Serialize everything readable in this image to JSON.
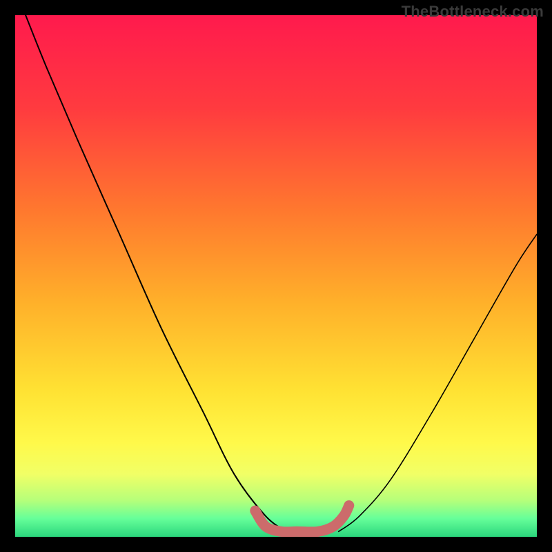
{
  "watermark": {
    "text": "TheBottleneck.com"
  },
  "chart_data": {
    "type": "line",
    "title": "",
    "xlabel": "",
    "ylabel": "",
    "xlim": [
      0,
      100
    ],
    "ylim": [
      0,
      100
    ],
    "grid": false,
    "series": [
      {
        "name": "curve-left",
        "color": "#000000",
        "x": [
          2,
          6,
          12,
          20,
          28,
          36,
          42,
          48,
          52
        ],
        "y": [
          100,
          90,
          76,
          58,
          40,
          24,
          12,
          4,
          1
        ]
      },
      {
        "name": "curve-right",
        "color": "#000000",
        "x": [
          62,
          66,
          72,
          80,
          88,
          96,
          100
        ],
        "y": [
          1,
          4,
          11,
          24,
          38,
          52,
          58
        ]
      },
      {
        "name": "highlight-bottom",
        "color": "#cc6b6b",
        "x": [
          46,
          48,
          51,
          54,
          58,
          61,
          63,
          64
        ],
        "y": [
          5,
          2,
          1,
          1,
          1,
          2,
          4,
          6
        ]
      }
    ],
    "background_gradient": {
      "stops": [
        {
          "offset": 0.0,
          "color": "#ff1a4d"
        },
        {
          "offset": 0.18,
          "color": "#ff3b3f"
        },
        {
          "offset": 0.38,
          "color": "#ff7a2e"
        },
        {
          "offset": 0.55,
          "color": "#ffb02a"
        },
        {
          "offset": 0.72,
          "color": "#ffe233"
        },
        {
          "offset": 0.82,
          "color": "#fff94a"
        },
        {
          "offset": 0.88,
          "color": "#f1ff66"
        },
        {
          "offset": 0.93,
          "color": "#b6ff7a"
        },
        {
          "offset": 0.965,
          "color": "#66ff99"
        },
        {
          "offset": 1.0,
          "color": "#2bd67d"
        }
      ]
    }
  }
}
